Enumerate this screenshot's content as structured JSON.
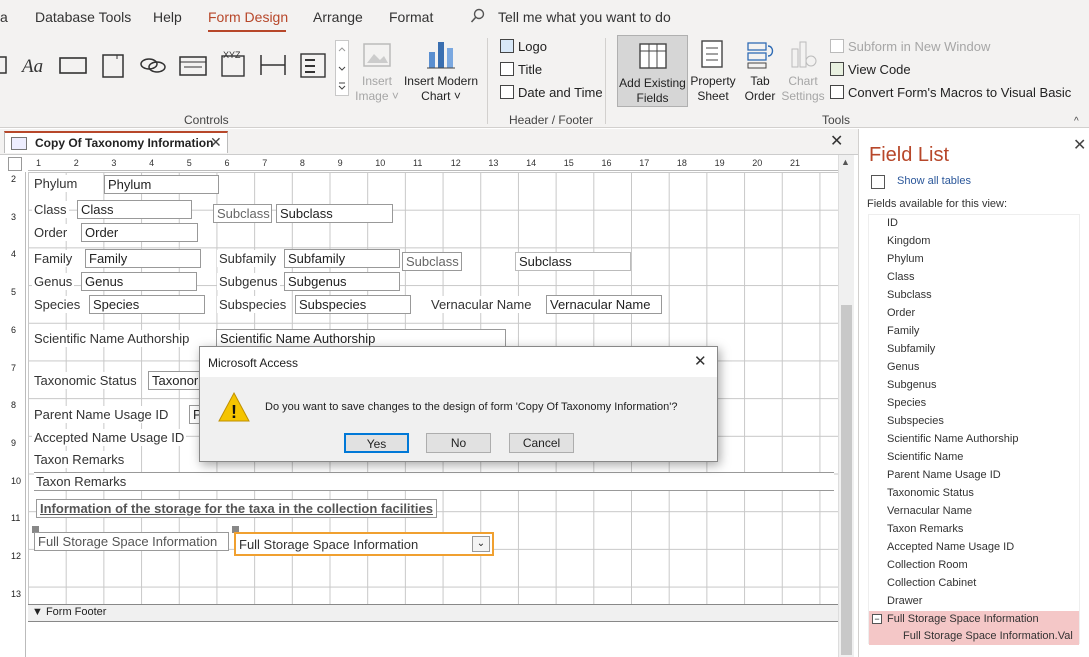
{
  "menubar": {
    "items": [
      "a",
      "Database Tools",
      "Help",
      "Form Design",
      "Arrange",
      "Format"
    ],
    "tell_me": "Tell me what you want to do"
  },
  "ribbon": {
    "controls_label": "Controls",
    "insert_image": "Insert Image ˅",
    "insert_modern_chart": "Insert Modern Chart ˅",
    "logo": "Logo",
    "title": "Title",
    "date_time": "Date and Time",
    "header_footer_label": "Header / Footer",
    "add_existing_fields": "Add Existing Fields",
    "property_sheet": "Property Sheet",
    "tab_order": "Tab Order",
    "chart_settings": "Chart Settings",
    "subform_new_window": "Subform in New Window",
    "view_code": "View Code",
    "convert_macros": "Convert Form's Macros to Visual Basic",
    "tools_label": "Tools"
  },
  "document": {
    "tab_title": "Copy Of Taxonomy Information",
    "ruler_numbers": [
      "1",
      "2",
      "3",
      "4",
      "5",
      "6",
      "7",
      "8",
      "9",
      "10",
      "11",
      "12",
      "13",
      "14",
      "15",
      "16",
      "17",
      "18",
      "19",
      "20",
      "21"
    ],
    "vruler_numbers": [
      "2",
      "3",
      "4",
      "5",
      "6",
      "7",
      "8",
      "9",
      "10",
      "11",
      "12",
      "13"
    ],
    "form_footer": "Form Footer"
  },
  "form": {
    "phylum_label": "Phylum",
    "phylum_box": "Phylum",
    "class_label": "Class",
    "class_box": "Class",
    "subclass_label": "Subclass",
    "subclass_box": "Subclass",
    "order_label": "Order",
    "order_box": "Order",
    "family_label": "Family",
    "family_box": "Family",
    "subfamily_label": "Subfamily",
    "subfamily_box": "Subfamily",
    "subclass2_label": "Subclass",
    "subclass2_box": "Subclass",
    "genus_label": "Genus",
    "genus_box": "Genus",
    "subgenus_label": "Subgenus",
    "subgenus_box": "Subgenus",
    "species_label": "Species",
    "species_box": "Species",
    "subspecies_label": "Subspecies",
    "subspecies_box": "Subspecies",
    "vernacular_label": "Vernacular Name",
    "vernacular_box": "Vernacular Name",
    "sci_auth_label": "Scientific Name Authorship",
    "sci_auth_box": "Scientific Name Authorship",
    "tax_status_label": "Taxonomic Status",
    "tax_status_box": "Taxonor",
    "parent_label": "Parent Name Usage ID",
    "parent_box": "P",
    "accepted_label": "Accepted Name Usage ID",
    "remarks_label": "Taxon Remarks",
    "remarks_box": "Taxon Remarks",
    "storage_heading": "Information of the storage for the taxa in the collection facilities",
    "storage_label": "Full Storage Space Information",
    "storage_combo": "Full Storage Space Information"
  },
  "field_list": {
    "title": "Field List",
    "show_all": "Show all tables",
    "caption": "Fields available for this view:",
    "fields": [
      "ID",
      "Kingdom",
      "Phylum",
      "Class",
      "Subclass",
      "Order",
      "Family",
      "Subfamily",
      "Genus",
      "Subgenus",
      "Species",
      "Subspecies",
      "Scientific Name Authorship",
      "Scientific Name",
      "Parent Name Usage ID",
      "Taxonomic Status",
      "Vernacular Name",
      "Taxon Remarks",
      "Accepted Name Usage ID",
      "Collection Room",
      "Collection Cabinet",
      "Drawer"
    ],
    "expanded": "Full Storage Space Information",
    "sub_field": "Full Storage Space Information.Val",
    "highlight_color": "#f4c7c7"
  },
  "dialog": {
    "title": "Microsoft Access",
    "message": "Do you want to save changes to the design of form 'Copy Of Taxonomy Information'?",
    "yes": "Yes",
    "no": "No",
    "cancel": "Cancel"
  },
  "colors": {
    "accent": "#b7472a",
    "selection": "#f0a030",
    "warning": "#f5c400"
  }
}
